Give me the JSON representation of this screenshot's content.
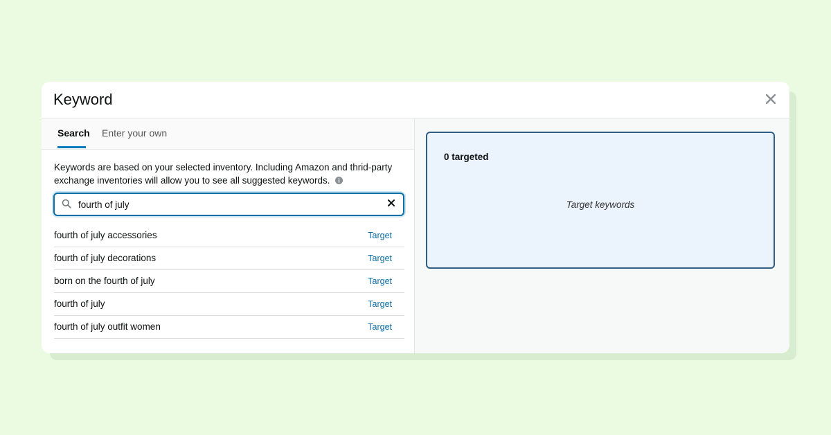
{
  "modal": {
    "title": "Keyword"
  },
  "tabs": [
    {
      "label": "Search",
      "active": true
    },
    {
      "label": "Enter your own",
      "active": false
    }
  ],
  "description": "Keywords are based on your selected inventory. Including Amazon and thrid-party exchange inventories will allow you to see all suggested keywords.",
  "search": {
    "value": "fourth of july"
  },
  "results": [
    {
      "keyword": "fourth of july accessories",
      "action": "Target"
    },
    {
      "keyword": "fourth of july decorations",
      "action": "Target"
    },
    {
      "keyword": "born on the fourth of july",
      "action": "Target"
    },
    {
      "keyword": "fourth of july",
      "action": "Target"
    },
    {
      "keyword": "fourth of july outfit women",
      "action": "Target"
    }
  ],
  "targeted": {
    "count_label": "0 targeted",
    "placeholder": "Target keywords"
  },
  "colors": {
    "background": "#eafbe2",
    "accent": "#0a6ea8",
    "panel_border": "#2e5d86",
    "panel_fill": "#ebf3fd"
  },
  "icons": [
    "close-icon",
    "search-icon",
    "clear-icon",
    "info-icon"
  ]
}
